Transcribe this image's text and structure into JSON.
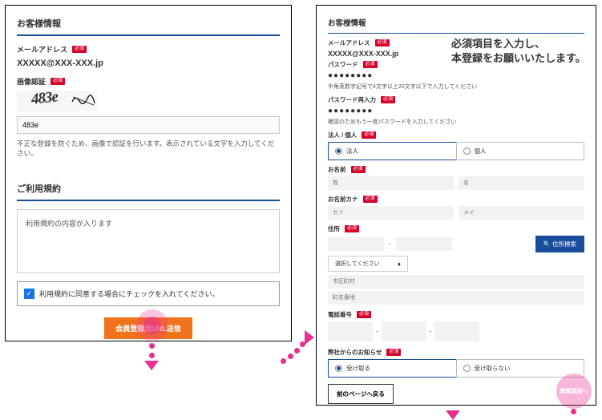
{
  "left": {
    "section_title": "お客様情報",
    "email_label": "メールアドレス",
    "req_badge": "必須",
    "email_value": "XXXXX@XXX-XXX.jp",
    "captcha_label": "画像認証",
    "captcha_value": "483e",
    "captcha_input_value": "483e",
    "captcha_helper": "不正な登録を防ぐため、画像で認証を行います。表示されている文字を入力してください。",
    "terms_title": "ご利用規約",
    "terms_body": "利用規約の内容が入ります",
    "agree_text": "利用規約に同意する場合にチェックを入れてください。",
    "submit_label": "会員登録用URL送信"
  },
  "right": {
    "section_title": "お客様情報",
    "email_label": "メールアドレス",
    "req_badge": "必須",
    "email_value": "XXXXX@XXX-XXX.jp",
    "password_label": "パスワード",
    "password_dots": "●●●●●●●●",
    "password_helper": "半角英数字記号で4文字以上20文字以下で入力してください",
    "password_confirm_label": "パスワード再入力",
    "password_confirm_dots": "●●●●●●●●",
    "password_confirm_helper": "確認のためもう一度パスワードを入力してください",
    "entity_label": "法人 / 個人",
    "entity_corporate": "法人",
    "entity_individual": "個人",
    "name_label": "お名前",
    "name_sei_ph": "姓",
    "name_mei_ph": "名",
    "kana_label": "お名前カナ",
    "kana_sei_ph": "セイ",
    "kana_mei_ph": "メイ",
    "address_label": "住所",
    "addr_search_label": "住所検索",
    "select_placeholder": "選択してください",
    "city_ph": "市区町村",
    "street_ph": "町名番地",
    "tel_label": "電話番号",
    "news_label": "弊社からのお知らせ",
    "news_subscribe": "受け取る",
    "news_unsubscribe": "受け取らない",
    "back_label": "前のページへ戻る",
    "confirm_label": "確認画面へ"
  },
  "callout": {
    "line1": "必須項目を入力し、",
    "line2": "本登録をお願いいたします。"
  },
  "icons": {
    "search": "🔍",
    "sort": "◆"
  }
}
